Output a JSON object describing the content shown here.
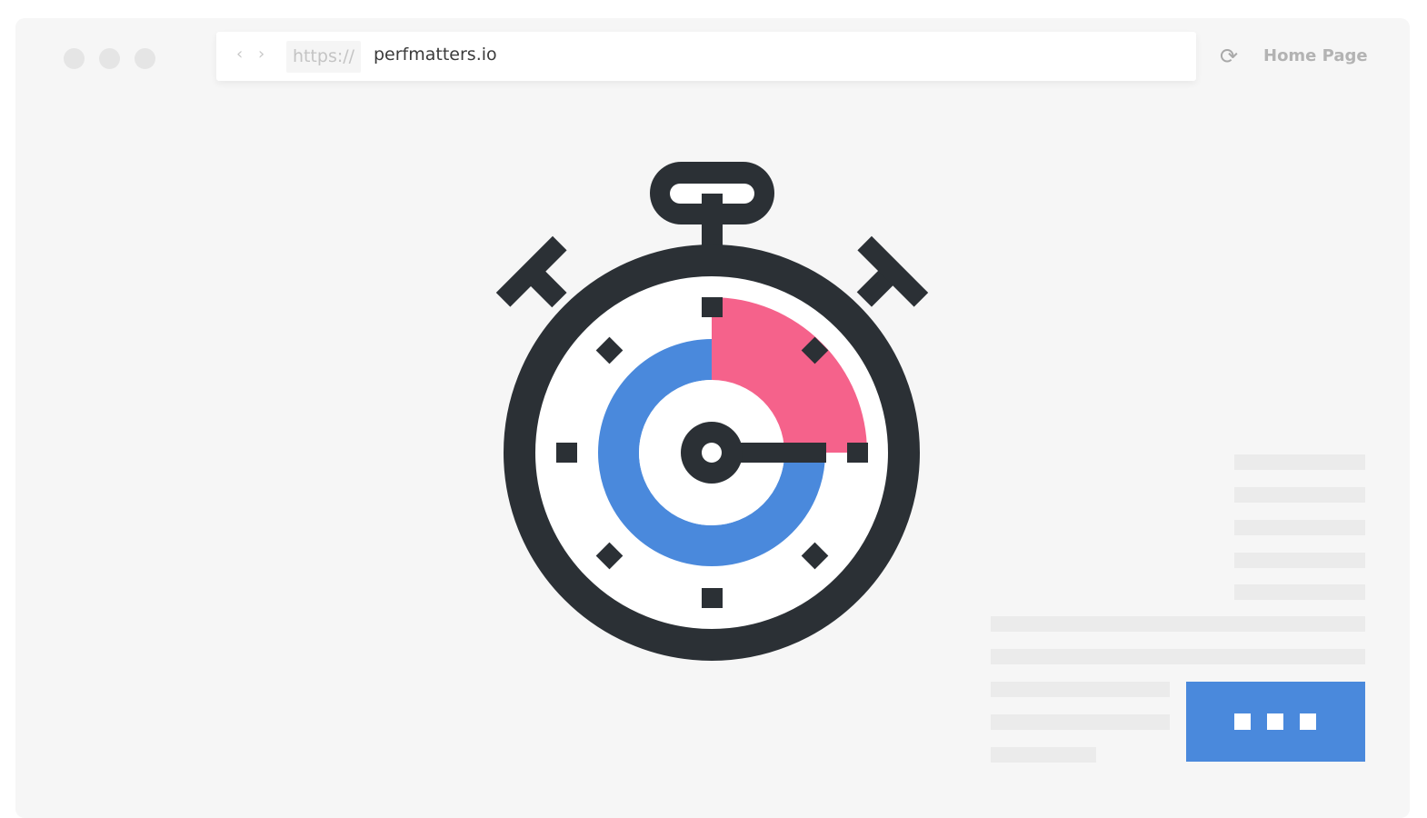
{
  "browser": {
    "back_icon": "chevron-left",
    "forward_icon": "chevron-right",
    "protocol": "https://",
    "url": "perfmatters.io",
    "reload_icon": "refresh",
    "home_label": "Home Page"
  },
  "illustration": {
    "subject": "stopwatch",
    "colors": {
      "dark": "#2b3035",
      "blue": "#4a89dc",
      "pink": "#f5628b",
      "placeholder": "#ebebeb"
    }
  }
}
